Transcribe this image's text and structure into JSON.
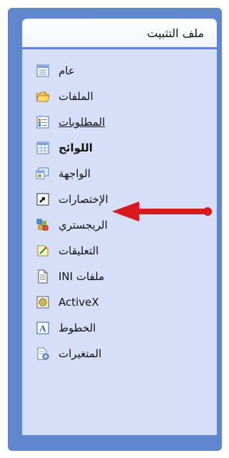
{
  "panel": {
    "title": "ملف التثبيت"
  },
  "menu": {
    "items": [
      {
        "label": "عام",
        "icon": "list-icon"
      },
      {
        "label": "الملفات",
        "icon": "folder-icon"
      },
      {
        "label": "المطلوبات",
        "icon": "checklist-icon"
      },
      {
        "label": "اللوائح",
        "icon": "grid-icon"
      },
      {
        "label": "الواجهة",
        "icon": "interface-icon"
      },
      {
        "label": "الإختصارات",
        "icon": "shortcut-arrow-icon"
      },
      {
        "label": "الريجستري",
        "icon": "registry-icon"
      },
      {
        "label": "التعليقات",
        "icon": "notes-icon"
      },
      {
        "label": "ملفات INI",
        "icon": "ini-file-icon"
      },
      {
        "label": "ActiveX",
        "icon": "activex-icon"
      },
      {
        "label": "الخطوط",
        "icon": "font-icon"
      },
      {
        "label": "المتغيرات",
        "icon": "variables-icon"
      }
    ]
  },
  "colors": {
    "panel_border": "#5f86cf",
    "panel_body": "#d6dff7",
    "arrow": "#d71920"
  }
}
